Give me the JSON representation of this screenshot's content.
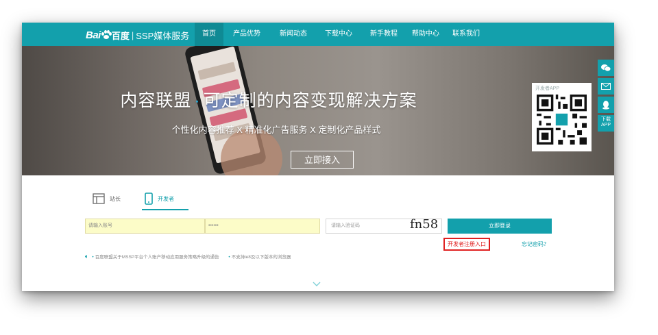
{
  "nav": {
    "logo_bai": "Bai",
    "logo_du": "百度",
    "logo_sep": "|",
    "logo_service": "SSP媒体服务",
    "items": [
      "首页",
      "产品优势",
      "新闻动态",
      "下载中心",
      "新手教程",
      "帮助中心",
      "联系我们"
    ],
    "active_index": 0
  },
  "banner": {
    "title_left": "内容联盟",
    "title_dot": "·",
    "title_right": "可定制的内容变现解决方案",
    "subtitle": "个性化内容推荐 X 精准化广告服务 X 定制化产品样式",
    "cta": "立即接入",
    "slide_count": 5,
    "active_slide": 0
  },
  "sidebar": {
    "qr_label": "开发者APP",
    "buttons": [
      {
        "icon": "wechat-icon",
        "glyph": "✉"
      },
      {
        "icon": "mail-icon",
        "glyph": "✉"
      },
      {
        "icon": "qq-icon",
        "glyph": "♟"
      },
      {
        "icon": "download-app-icon",
        "line1": "下载",
        "line2": "APP"
      }
    ]
  },
  "login": {
    "tabs": [
      {
        "label": "站长",
        "icon": "webmaster-icon"
      },
      {
        "label": "开发者",
        "icon": "mobile-icon"
      }
    ],
    "active_tab": 1,
    "account_value": "请输入账号",
    "password_value": "••••••",
    "captcha_placeholder": "请输入验证码",
    "captcha_code": "fn58",
    "submit": "立即登录",
    "register": "开发者注册入口",
    "forgot": "忘记密码？"
  },
  "notice": {
    "item1": "百度联盟关于MSSP平台个人账户移动应用服务策略升级的通告",
    "item2": "不支持ie8及以下版本的浏览器"
  },
  "colors": {
    "accent": "#13a0ac",
    "accent_dark": "#0f8a94",
    "register_border": "#e02020",
    "autofill": "#fcfcc8"
  }
}
